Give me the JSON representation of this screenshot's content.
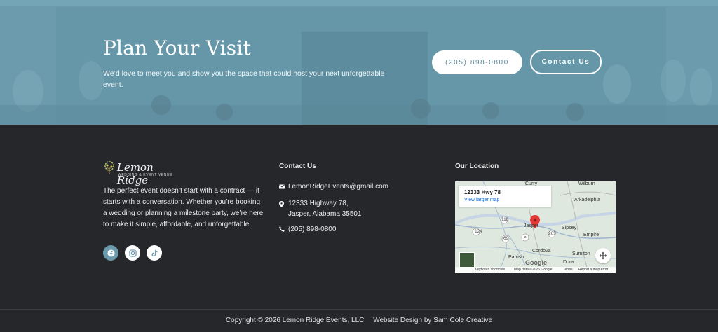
{
  "hero": {
    "title": "Plan Your Visit",
    "subtitle": "We’d love to meet you and show you the space that could host your next unforgettable event.",
    "phone_button": "(205) 898-0800",
    "contact_button": "Contact Us"
  },
  "footer": {
    "logo": {
      "name": "Lemon Ridge",
      "tagline": "WEDDING & EVENT VENUE"
    },
    "about": "The perfect event doesn’t start with a contract — it starts with a conversation. Whether you’re booking a wedding or planning a milestone party, we’re here to make it simple, affordable, and unforgettable.",
    "socials": [
      {
        "name": "facebook-icon"
      },
      {
        "name": "instagram-icon"
      },
      {
        "name": "tiktok-icon"
      }
    ],
    "contact": {
      "title": "Contact Us",
      "email": "LemonRidgeEvents@gmail.com",
      "address_line1": "12333 Highway 78,",
      "address_line2": "Jasper, Alabama 35501",
      "phone": "(205) 898-0800"
    },
    "location": {
      "title": "Our Location",
      "map": {
        "address": "12333 Hwy 78",
        "larger_link": "View larger map",
        "cities": [
          "Curry",
          "Wilburn",
          "Arkadelphia",
          "Jasper",
          "Sipsey",
          "Empire",
          "Cordova",
          "Parrish",
          "Sumiton",
          "Dora"
        ],
        "road_labels": [
          "124",
          "118",
          "69",
          "5",
          "269"
        ],
        "footer": [
          "Keyboard shortcuts",
          "Map data ©2026 Google",
          "Terms",
          "Report a map error"
        ],
        "brand": "Google"
      }
    },
    "copyright": "Copyright © 2026 Lemon Ridge Events, LLC",
    "credit": "Website Design by Sam Cole Creative"
  },
  "colors": {
    "accent": "#6a9aac",
    "footer_bg": "#25272b",
    "white": "#ffffff"
  }
}
